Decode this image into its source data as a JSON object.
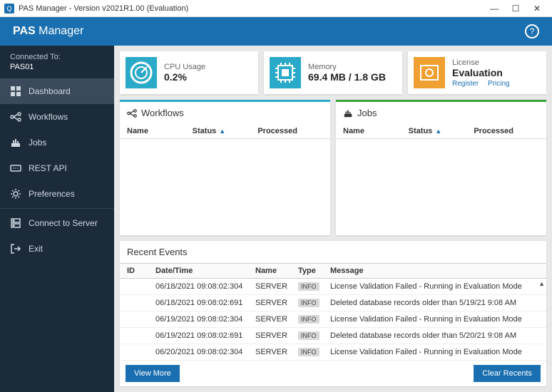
{
  "window": {
    "title": "PAS Manager - Version v2021R1.00 (Evaluation)"
  },
  "header": {
    "brand_bold": "PAS",
    "brand_light": " Manager"
  },
  "sidebar": {
    "connected_label": "Connected To:",
    "connected_value": "PAS01",
    "items": [
      {
        "label": "Dashboard"
      },
      {
        "label": "Workflows"
      },
      {
        "label": "Jobs"
      },
      {
        "label": "REST API"
      },
      {
        "label": "Preferences"
      },
      {
        "label": "Connect to Server"
      },
      {
        "label": "Exit"
      }
    ]
  },
  "cards": {
    "cpu": {
      "label": "CPU Usage",
      "value": "0.2%"
    },
    "memory": {
      "label": "Memory",
      "value": "69.4 MB / 1.8 GB"
    },
    "license": {
      "label": "License",
      "value": "Evaluation",
      "link_register": "Register",
      "link_pricing": "Pricing"
    }
  },
  "workflows": {
    "title": "Workflows",
    "columns": {
      "name": "Name",
      "status": "Status",
      "processed": "Processed"
    }
  },
  "jobs": {
    "title": "Jobs",
    "columns": {
      "name": "Name",
      "status": "Status",
      "processed": "Processed"
    }
  },
  "events": {
    "title": "Recent Events",
    "columns": {
      "id": "ID",
      "datetime": "Date/Time",
      "name": "Name",
      "type": "Type",
      "message": "Message"
    },
    "rows": [
      {
        "datetime": "06/18/2021 09:08:02:304",
        "name": "SERVER",
        "type": "INFO",
        "message": "License Validation Failed - Running in Evaluation Mode"
      },
      {
        "datetime": "06/18/2021 09:08:02:691",
        "name": "SERVER",
        "type": "INFO",
        "message": "Deleted database records older than 5/19/21 9:08 AM"
      },
      {
        "datetime": "06/19/2021 09:08:02:304",
        "name": "SERVER",
        "type": "INFO",
        "message": "License Validation Failed - Running in Evaluation Mode"
      },
      {
        "datetime": "06/19/2021 09:08:02:691",
        "name": "SERVER",
        "type": "INFO",
        "message": "Deleted database records older than 5/20/21 9:08 AM"
      },
      {
        "datetime": "06/20/2021 09:08:02:304",
        "name": "SERVER",
        "type": "INFO",
        "message": "License Validation Failed - Running in Evaluation Mode"
      }
    ],
    "view_more": "View More",
    "clear": "Clear Recents"
  }
}
